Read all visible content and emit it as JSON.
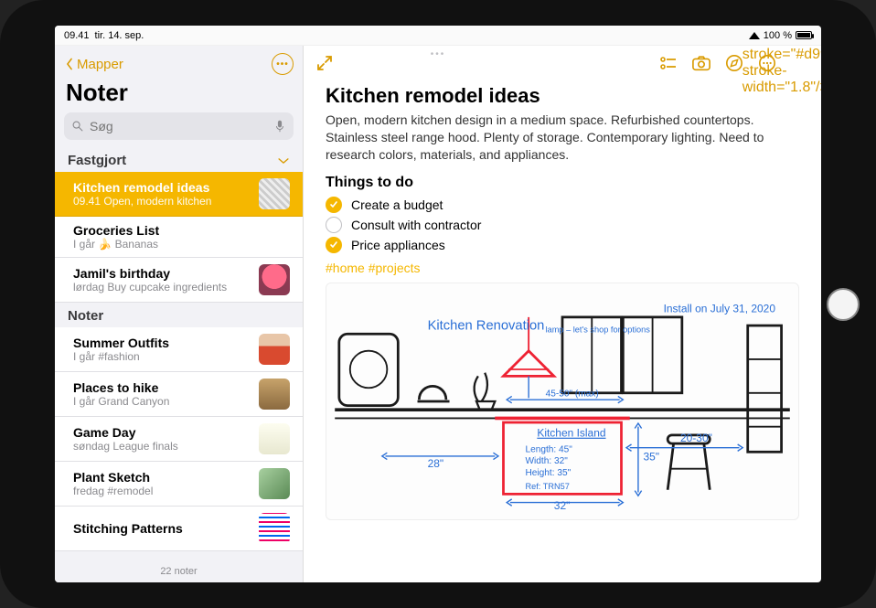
{
  "status": {
    "time": "09.41",
    "date": "tir. 14. sep.",
    "battery": "100 %"
  },
  "sidebar": {
    "back_label": "Mapper",
    "title": "Noter",
    "search_placeholder": "Søg",
    "pinned_header": "Fastgjort",
    "notes_header": "Noter",
    "footer": "22 noter",
    "pinned": [
      {
        "title": "Kitchen remodel ideas",
        "sub": "09.41  Open, modern kitchen"
      },
      {
        "title": "Groceries List",
        "sub": "I går 🍌 Bananas"
      },
      {
        "title": "Jamil's birthday",
        "sub": "lørdag Buy cupcake ingredients"
      }
    ],
    "notes": [
      {
        "title": "Summer Outfits",
        "sub": "I går #fashion"
      },
      {
        "title": "Places to hike",
        "sub": "I går Grand Canyon"
      },
      {
        "title": "Game Day",
        "sub": "søndag League finals"
      },
      {
        "title": "Plant Sketch",
        "sub": "fredag #remodel"
      },
      {
        "title": "Stitching Patterns",
        "sub": ""
      }
    ]
  },
  "note": {
    "title": "Kitchen remodel ideas",
    "body": "Open, modern kitchen design in a medium space. Refurbished countertops. Stainless steel range hood. Plenty of storage. Contemporary lighting. Need to research colors, materials, and appliances.",
    "things_header": "Things to do",
    "todos": [
      {
        "label": "Create a budget",
        "done": true
      },
      {
        "label": "Consult with contractor",
        "done": false
      },
      {
        "label": "Price appliances",
        "done": true
      }
    ],
    "tags": "#home #projects",
    "sketch_caption": "Install on July 31, 2020",
    "sketch_title": "Kitchen Renovation",
    "sketch_island_label": "Kitchen Island",
    "sketch_dims": {
      "length": "Length: 45\"",
      "width": "Width: 32\"",
      "height": "Height: 35\"",
      "ref": "Ref: TRN57",
      "left": "28\"",
      "right": "20-30\"",
      "base": "32\"",
      "height_right": "35\"",
      "top": "45-50\" (max)",
      "lamp_note": "lamp – let's shop for options"
    }
  }
}
